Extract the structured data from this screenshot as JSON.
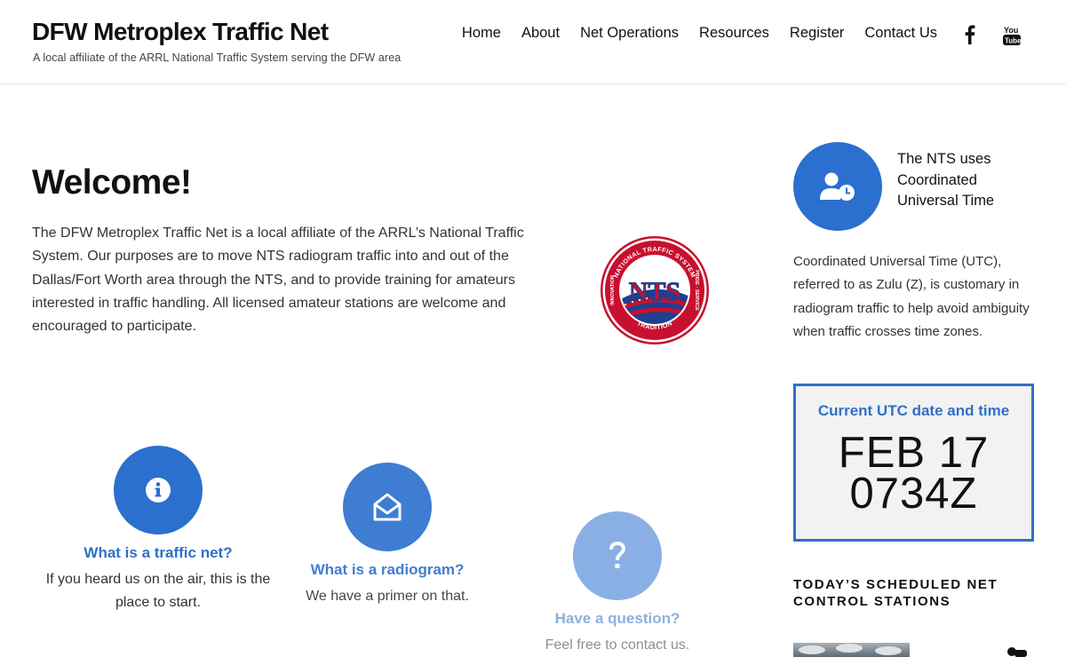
{
  "site": {
    "title": "DFW Metroplex Traffic Net",
    "tagline": "A local affiliate of the ARRL National Traffic System serving the DFW area"
  },
  "nav": {
    "items": [
      "Home",
      "About",
      "Net Operations",
      "Resources",
      "Register",
      "Contact Us"
    ],
    "social": [
      "facebook-icon",
      "youtube-icon"
    ]
  },
  "main": {
    "welcome_title": "Welcome!",
    "welcome_text": "The DFW Metroplex Traffic Net is a local affiliate of the ARRL’s National Traffic System. Our purposes are to move NTS radiogram traffic into and out of the Dallas/Fort Worth area through the NTS, and to provide training for amateurs interested in traffic handling. All licensed amateur stations are welcome and encouraged to participate.",
    "logo": {
      "ring_top": "NATIONAL TRAFFIC SYSTEM",
      "ring_right": "PRIDE · SERVICE",
      "ring_bottom": "TRADITION",
      "ring_left": "INNOVATION",
      "center": "NTS"
    },
    "features": [
      {
        "icon": "info-icon",
        "title": "What is a traffic net?",
        "text": "If you heard us on the air, this is the place to start."
      },
      {
        "icon": "envelope-open-icon",
        "title": "What is a radiogram?",
        "text": "We have a primer on that."
      },
      {
        "icon": "question-icon",
        "title": "Have a question?",
        "text": "Feel free to contact us."
      }
    ]
  },
  "sidebar": {
    "utc_heading": "The NTS uses Coordinated Universal Time",
    "utc_text": "Coordinated Universal Time (UTC), referred to as Zulu (Z), is customary in radiogram traffic to help avoid ambiguity when traffic crosses time zones.",
    "clock": {
      "label": "Current UTC date and time",
      "date": "FEB 17",
      "time": "0734Z"
    },
    "schedule_heading": "TODAY’S SCHEDULED NET CONTROL STATIONS"
  },
  "colors": {
    "accent": "#2b6fcf",
    "link": "#2f6fc9",
    "text": "#333333"
  }
}
